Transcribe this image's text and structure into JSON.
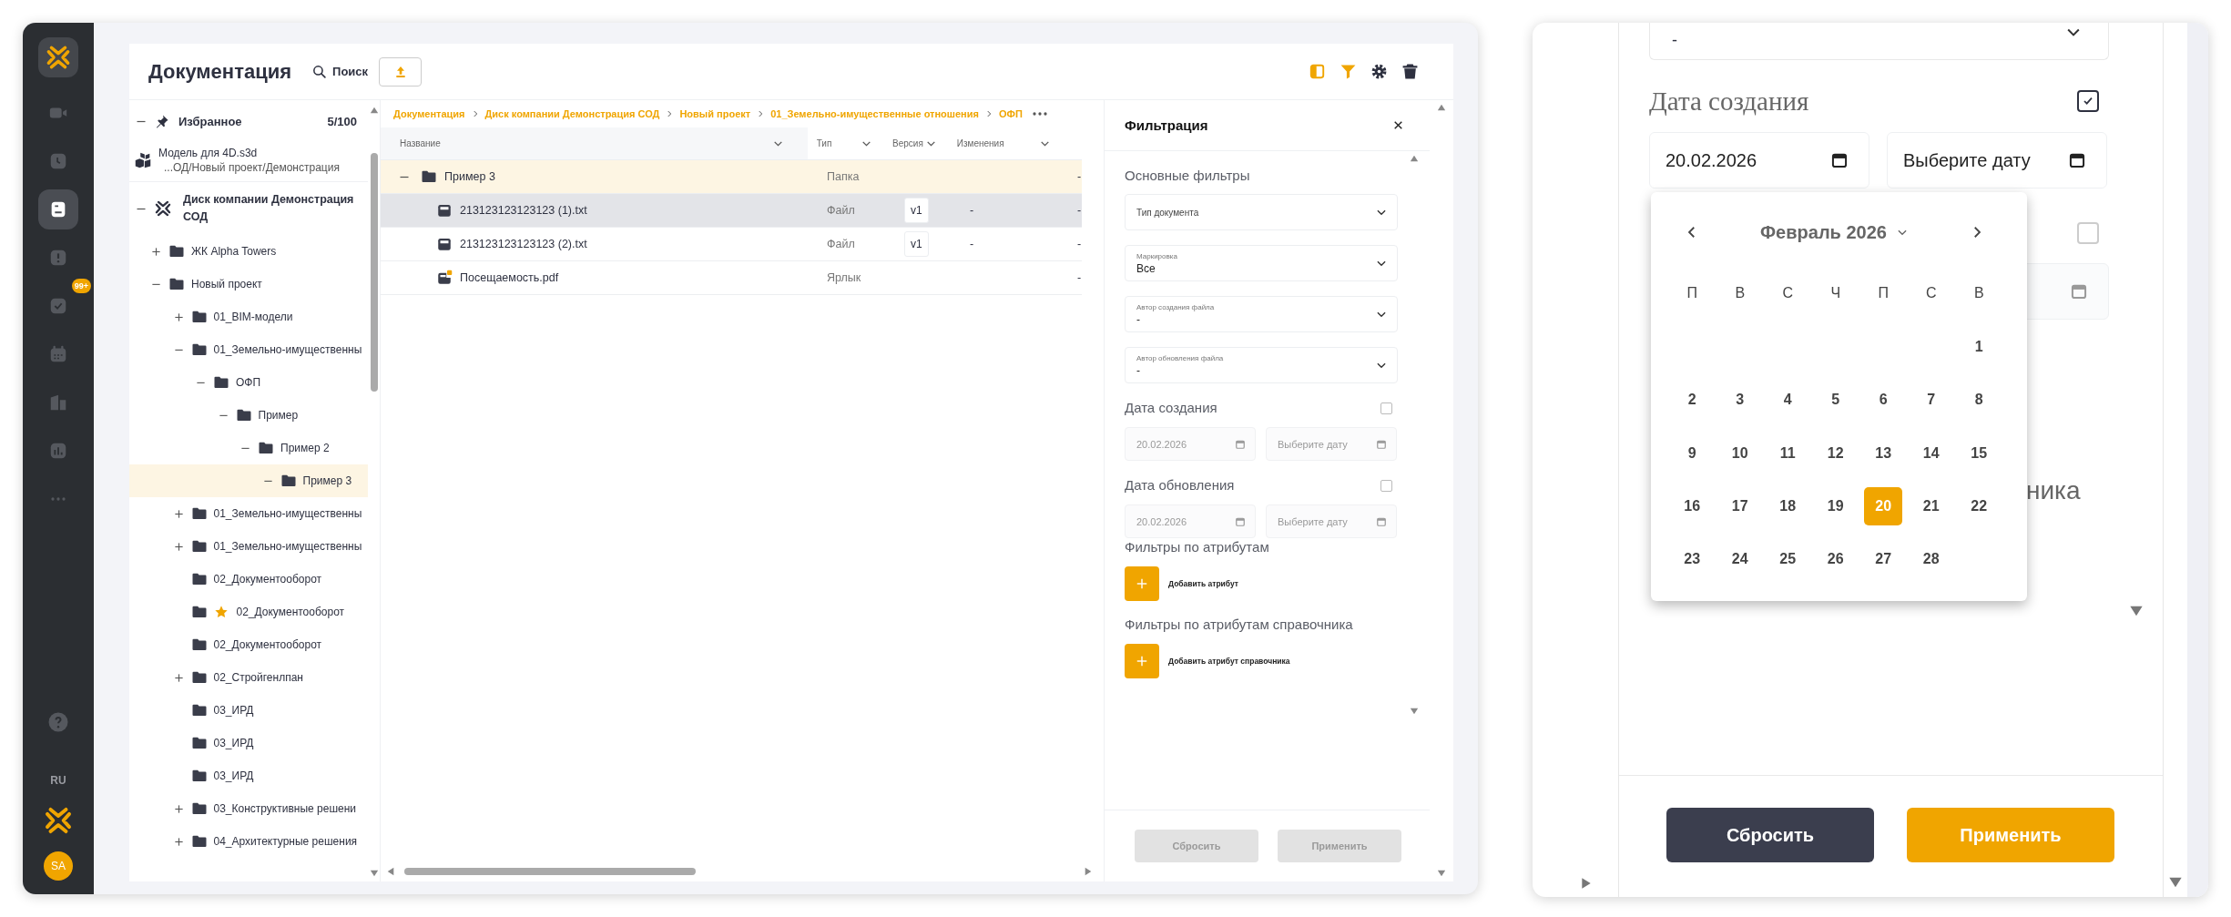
{
  "rail": {
    "items": [
      {
        "kind": "video",
        "selected": false
      },
      {
        "kind": "clock",
        "selected": false
      },
      {
        "kind": "documents",
        "selected": true
      },
      {
        "kind": "alert",
        "selected": false
      },
      {
        "kind": "tasks",
        "selected": false,
        "badge": "99+"
      },
      {
        "kind": "calendar",
        "selected": false
      },
      {
        "kind": "building",
        "selected": false
      },
      {
        "kind": "chart",
        "selected": false
      },
      {
        "kind": "more",
        "selected": false
      }
    ],
    "language": "RU",
    "avatar": "SA"
  },
  "header": {
    "title": "Документация",
    "search": "Поиск",
    "toolbar": [
      {
        "kind": "panel",
        "active": true
      },
      {
        "kind": "filter",
        "active": true
      },
      {
        "kind": "settings",
        "active": false
      },
      {
        "kind": "delete",
        "active": false
      }
    ]
  },
  "favorites": {
    "title": "Избранное",
    "count": "5/100",
    "expanded": true,
    "items": [
      {
        "name": "Модель для 4D.s3d",
        "path": "...ОД/Новый проект/Демонстрация"
      }
    ]
  },
  "tree": {
    "label": "Диск компании Демонстрация СОД",
    "expanded": true,
    "children": [
      {
        "label": "ЖК Alpha Towers",
        "expanded": false,
        "selected": false,
        "starred": false
      },
      {
        "label": "Новый проект",
        "expanded": true,
        "selected": false,
        "starred": false,
        "children": [
          {
            "label": "01_BIM-модели",
            "expanded": false,
            "selected": false,
            "starred": false
          },
          {
            "label": "01_Земельно-имущественны",
            "expanded": true,
            "selected": false,
            "starred": false,
            "children": [
              {
                "label": "ОФП",
                "expanded": true,
                "selected": false,
                "starred": false,
                "children": [
                  {
                    "label": "Пример",
                    "expanded": true,
                    "selected": false,
                    "starred": false,
                    "children": [
                      {
                        "label": "Пример 2",
                        "expanded": true,
                        "selected": false,
                        "starred": false,
                        "children": [
                          {
                            "label": "Пример 3",
                            "expanded": true,
                            "selected": true,
                            "starred": false
                          }
                        ]
                      }
                    ]
                  }
                ]
              }
            ]
          },
          {
            "label": "01_Земельно-имущественны",
            "expanded": false,
            "selected": false,
            "starred": false
          },
          {
            "label": "01_Земельно-имущественны",
            "expanded": false,
            "selected": false,
            "starred": false
          },
          {
            "label": "02_Документооборот",
            "selected": false,
            "starred": false
          },
          {
            "label": "02_Документооборот",
            "selected": false,
            "starred": true
          },
          {
            "label": "02_Документооборот",
            "selected": false,
            "starred": false
          },
          {
            "label": "02_Стройгенлпан",
            "expanded": false,
            "selected": false,
            "starred": false
          },
          {
            "label": "03_ИРД",
            "selected": false,
            "starred": false
          },
          {
            "label": "03_ИРД",
            "selected": false,
            "starred": false
          },
          {
            "label": "03_ИРД",
            "selected": false,
            "starred": false
          },
          {
            "label": "03_Конструктивные решени",
            "expanded": false,
            "selected": false,
            "starred": false
          },
          {
            "label": "04_Архитектурные решения",
            "expanded": false,
            "selected": false,
            "starred": false
          }
        ]
      }
    ]
  },
  "table": {
    "breadcrumb": [
      "Документация",
      "Диск компании Демонстрация СОД",
      "Новый проект",
      "01_Земельно-имущественные отношения",
      "ОФП"
    ],
    "columns": [
      "Название",
      "Тип",
      "Версия",
      "Изменения"
    ],
    "rows": [
      {
        "kind": "folder",
        "name": "Пример 3",
        "expanded": true,
        "type": "Папка",
        "column_5": "-",
        "selected": true,
        "hovered": false
      },
      {
        "kind": "file",
        "name": "213123123123123 (1).txt",
        "type": "Файл",
        "version": "v1",
        "changes": "-",
        "column_5": "-",
        "selected": false,
        "hovered": true
      },
      {
        "kind": "file",
        "name": "213123123123123 (2).txt",
        "type": "Файл",
        "version": "v1",
        "changes": "-",
        "column_5": "-",
        "selected": false,
        "hovered": false
      },
      {
        "kind": "shortcut",
        "name": "Посещаемость.pdf",
        "type": "Ярлык",
        "column_5": "-",
        "selected": false,
        "hovered": false
      }
    ]
  },
  "filter": {
    "title": "Фильтрация",
    "main_heading": "Основные фильтры",
    "dropdowns": [
      {
        "placeholder": "Тип документа"
      },
      {
        "label": "Маркировка",
        "value": "Все"
      },
      {
        "label": "Автор создания файла",
        "value": "-"
      },
      {
        "label": "Автор обновления файла",
        "value": "-"
      }
    ],
    "date_sections": [
      {
        "title": "Дата создания",
        "checked": false,
        "from": "20.02.2026",
        "to_placeholder": "Выберите дату"
      },
      {
        "title": "Дата обновления",
        "checked": false,
        "from": "20.02.2026",
        "to_placeholder": "Выберите дату"
      }
    ],
    "attribute_sections": [
      {
        "title": "Фильтры по атрибутам",
        "button": "Добавить атрибут"
      },
      {
        "title": "Фильтры по атрибутам справочника",
        "button": "Добавить атрибут справочника"
      }
    ],
    "buttons": [
      {
        "label": "Сбросить",
        "disabled": true
      },
      {
        "label": "Применить",
        "disabled": true
      }
    ]
  },
  "zoom_view": {
    "dropdown_value": "-",
    "date_section": {
      "title": "Дата создания",
      "checked": true,
      "from": "20.02.2026",
      "to_placeholder": "Выберите дату"
    },
    "update_date_checkbox": {
      "checked": false
    },
    "heading_tail": "ника",
    "calendar": {
      "title": "Февраль 2026",
      "weekdays": [
        "П",
        "В",
        "С",
        "Ч",
        "П",
        "С",
        "В"
      ],
      "weeks": [
        {
          "kind": "leading",
          "days": [
            {
              "label": "1",
              "selected": false
            }
          ]
        },
        {
          "days": [
            {
              "label": "2",
              "selected": false
            },
            {
              "label": "3",
              "selected": false
            },
            {
              "label": "4",
              "selected": false
            },
            {
              "label": "5",
              "selected": false
            },
            {
              "label": "6",
              "selected": false
            },
            {
              "label": "7",
              "selected": false
            },
            {
              "label": "8",
              "selected": false
            }
          ]
        },
        {
          "days": [
            {
              "label": "9",
              "selected": false
            },
            {
              "label": "10",
              "selected": false
            },
            {
              "label": "11",
              "selected": false
            },
            {
              "label": "12",
              "selected": false
            },
            {
              "label": "13",
              "selected": false
            },
            {
              "label": "14",
              "selected": false
            },
            {
              "label": "15",
              "selected": false
            }
          ]
        },
        {
          "days": [
            {
              "label": "16",
              "selected": false
            },
            {
              "label": "17",
              "selected": false
            },
            {
              "label": "18",
              "selected": false
            },
            {
              "label": "19",
              "selected": false
            },
            {
              "label": "20",
              "selected": true
            },
            {
              "label": "21",
              "selected": false
            },
            {
              "label": "22",
              "selected": false
            }
          ]
        },
        {
          "kind": "trailing",
          "days": [
            {
              "label": "23",
              "selected": false
            },
            {
              "label": "24",
              "selected": false
            },
            {
              "label": "25",
              "selected": false
            },
            {
              "label": "26",
              "selected": false
            },
            {
              "label": "27",
              "selected": false
            },
            {
              "label": "28",
              "selected": false
            }
          ]
        }
      ]
    },
    "buttons": [
      {
        "kind": "reset",
        "label": "Сбросить",
        "disabled": false
      },
      {
        "kind": "apply",
        "label": "Применить",
        "disabled": false
      }
    ]
  }
}
